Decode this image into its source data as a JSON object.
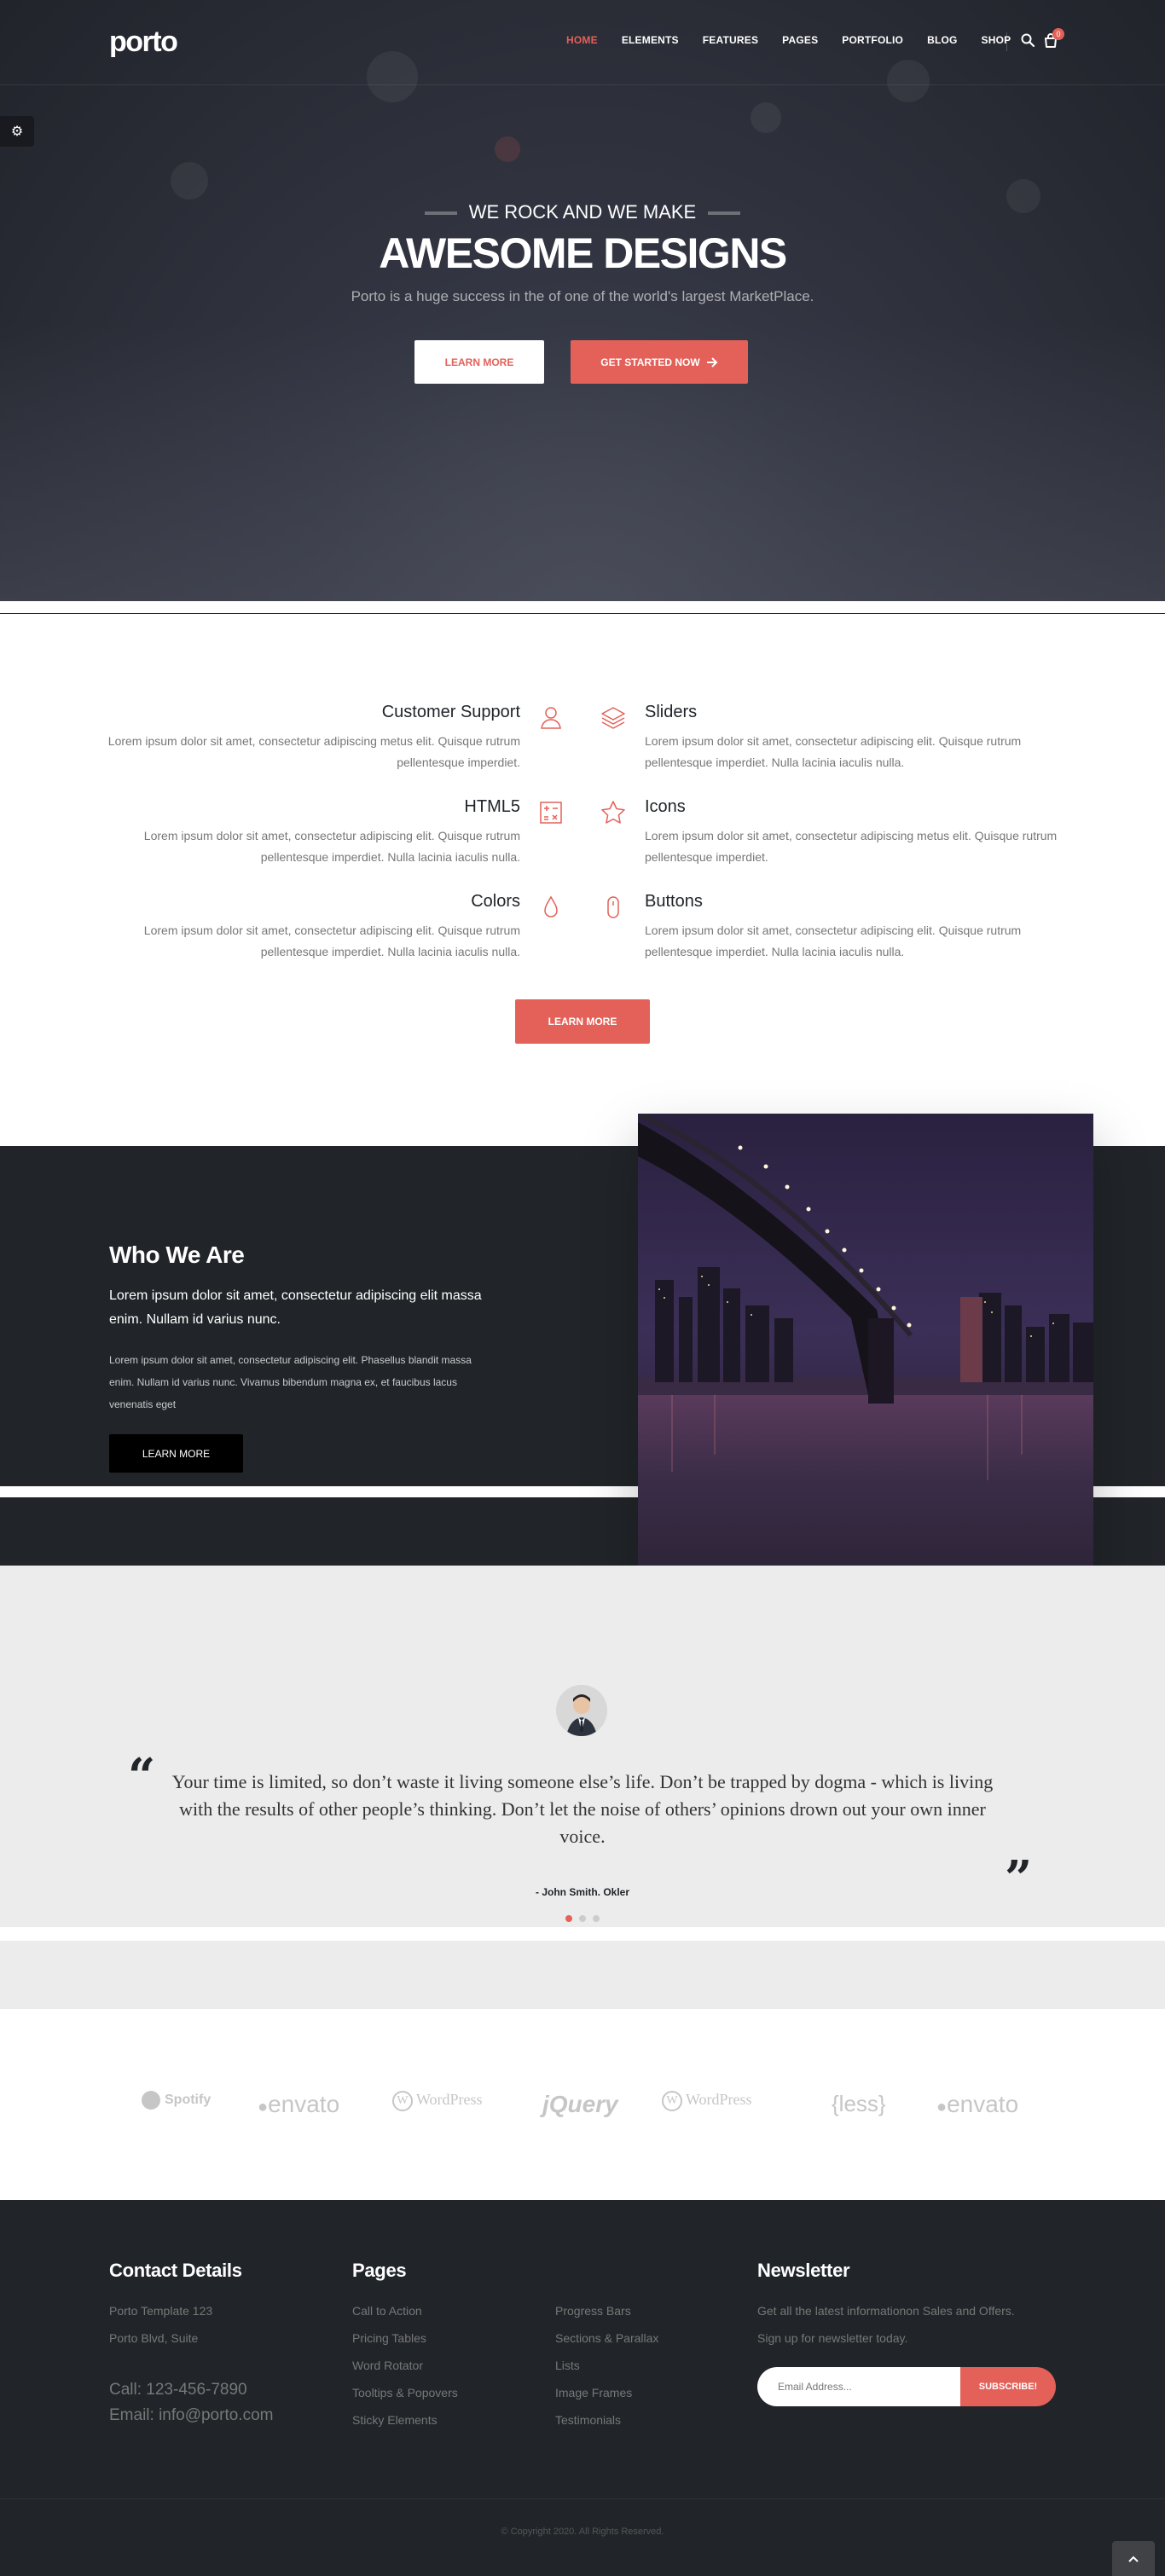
{
  "brand": {
    "logo": "porto",
    "accent": "#e36159",
    "dark": "#212529"
  },
  "nav": {
    "items": [
      {
        "label": "HOME",
        "active": true
      },
      {
        "label": "ELEMENTS"
      },
      {
        "label": "FEATURES"
      },
      {
        "label": "PAGES"
      },
      {
        "label": "PORTFOLIO"
      },
      {
        "label": "BLOG"
      },
      {
        "label": "SHOP"
      }
    ],
    "search_icon": "search-icon",
    "cart_icon": "cart-icon",
    "cart_count": "0"
  },
  "config_icon": "gears-icon",
  "hero": {
    "subtitle": "WE ROCK AND WE MAKE",
    "title": "AWESOME DESIGNS",
    "description": "Porto is a huge success in the of one of the world's largest MarketPlace.",
    "primary_button": "LEARN MORE",
    "secondary_button": "GET STARTED NOW",
    "secondary_button_icon": "arrow-right-icon"
  },
  "features": {
    "items": [
      {
        "title": "Customer Support",
        "text": "Lorem ipsum dolor sit amet, consectetur adipiscing metus elit. Quisque rutrum pellentesque imperdiet.",
        "icon": "user-icon"
      },
      {
        "title": "Sliders",
        "text": "Lorem ipsum dolor sit amet, consectetur adipiscing elit. Quisque rutrum pellentesque imperdiet. Nulla lacinia iaculis nulla.",
        "icon": "layers-icon"
      },
      {
        "title": "HTML5",
        "text": "Lorem ipsum dolor sit amet, consectetur adipiscing elit. Quisque rutrum pellentesque imperdiet. Nulla lacinia iaculis nulla.",
        "icon": "calculator-icon"
      },
      {
        "title": "Icons",
        "text": "Lorem ipsum dolor sit amet, consectetur adipiscing metus elit. Quisque rutrum pellentesque imperdiet.",
        "icon": "star-icon"
      },
      {
        "title": "Colors",
        "text": "Lorem ipsum dolor sit amet, consectetur adipiscing elit. Quisque rutrum pellentesque imperdiet. Nulla lacinia iaculis nulla.",
        "icon": "drop-icon"
      },
      {
        "title": "Buttons",
        "text": "Lorem ipsum dolor sit amet, consectetur adipiscing elit. Quisque rutrum pellentesque imperdiet. Nulla lacinia iaculis nulla.",
        "icon": "mouse-icon"
      }
    ],
    "button": "LEARN MORE"
  },
  "who": {
    "title": "Who We Are",
    "lead": "Lorem ipsum dolor sit amet, consectetur adipiscing elit massa enim. Nullam id varius nunc.",
    "text": "Lorem ipsum dolor sit amet, consectetur adipiscing elit. Phasellus blandit massa enim. Nullam id varius nunc. Vivamus bibendum magna ex, et faucibus lacus venenatis eget",
    "button": "LEARN MORE"
  },
  "testimonial": {
    "quote": "Your time is limited, so don’t waste it living someone else’s life. Don’t be trapped by dogma - which is living with the results of other people’s thinking. Don’t let the noise of others’ opinions drown out your own inner voice.",
    "author": "- John Smith. Okler",
    "open_mark": "“",
    "close_mark": "”",
    "slides": 3,
    "active_slide": 1
  },
  "clients": [
    "Spotify",
    "envato",
    "WordPress",
    "jQuery",
    "WordPress",
    "{less}",
    "envato"
  ],
  "footer": {
    "contact": {
      "title": "Contact Details",
      "line1": "Porto Template 123",
      "line2": "Porto Blvd, Suite",
      "phone": "Call: 123-456-7890",
      "email": "Email: info@porto.com"
    },
    "pages": {
      "title": "Pages",
      "col1": [
        "Call to Action",
        "Pricing Tables",
        "Word Rotator",
        "Tooltips & Popovers",
        "Sticky Elements"
      ],
      "col2": [
        "Progress Bars",
        "Sections & Parallax",
        "Lists",
        "Image Frames",
        "Testimonials"
      ]
    },
    "newsletter": {
      "title": "Newsletter",
      "text1": "Get all the latest informationon Sales and Offers.",
      "text2": "Sign up for newsletter today.",
      "placeholder": "Email Address...",
      "button": "SUBSCRIBE!"
    },
    "copyright": "© Copyright 2020. All Rights Reserved.",
    "to_top_icon": "chevron-up-icon"
  }
}
